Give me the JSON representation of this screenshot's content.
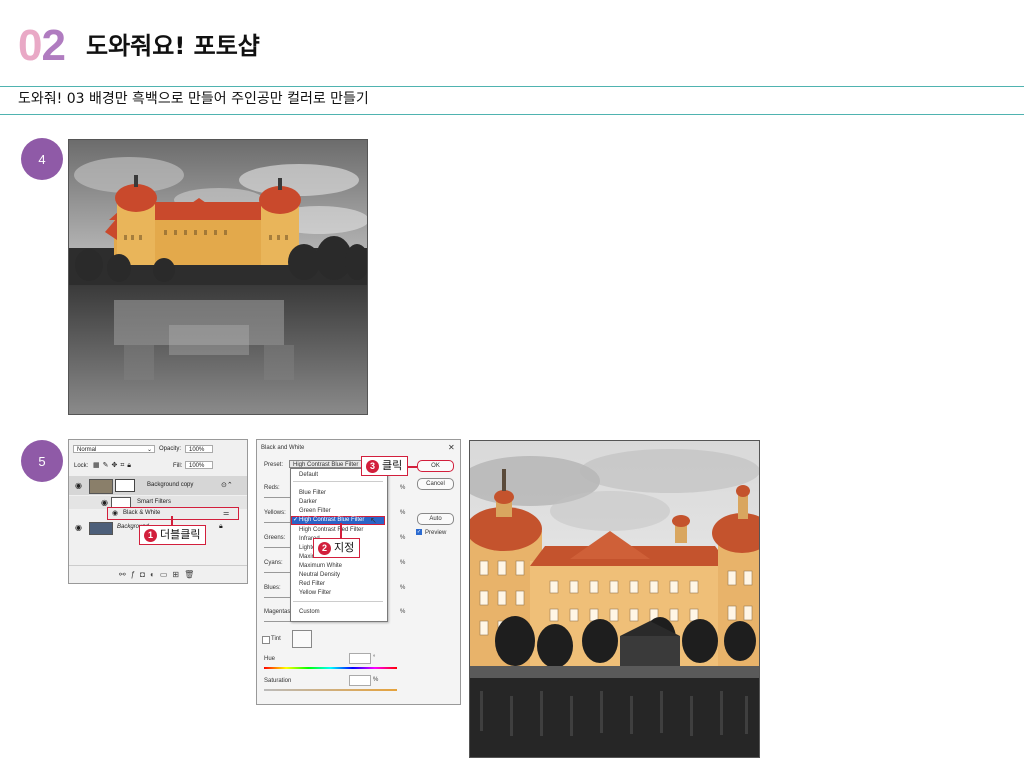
{
  "header": {
    "chapter_number": "02",
    "chapter_title": "도와줘요! 포토샵"
  },
  "subtitle": "도와줘! 03 배경만 흑백으로 만들어 주인공만 컬러로 만들기",
  "steps": {
    "step4": "4",
    "step5": "5"
  },
  "layers_panel": {
    "blend_mode": "Normal",
    "opacity_label": "Opacity:",
    "opacity_value": "100%",
    "lock_label": "Lock:",
    "fill_label": "Fill:",
    "fill_value": "100%",
    "layer_bg_copy": "Background copy",
    "smart_filters": "Smart Filters",
    "filter_bw": "Black & White",
    "layer_bg": "Background",
    "callout1_num": "1",
    "callout1_text": "더블클릭"
  },
  "bw_dialog": {
    "title": "Black and White",
    "preset_label": "Preset:",
    "preset_value": "High Contrast Blue Filter",
    "reds_label": "Reds:",
    "yellows_label": "Yellows:",
    "greens_label": "Greens:",
    "cyans_label": "Cyans:",
    "blues_label": "Blues:",
    "magentas_label": "Magentas:",
    "percent": "%",
    "ok": "OK",
    "cancel": "Cancel",
    "auto": "Auto",
    "preview": "Preview",
    "tint": "Tint",
    "hue": "Hue",
    "hue_unit": "°",
    "saturation": "Saturation",
    "sat_unit": "%",
    "dropdown_items": [
      "Default",
      "Blue Filter",
      "Darker",
      "Green Filter",
      "High Contrast Blue Filter",
      "High Contrast Red Filter",
      "Infrared",
      "Lighter",
      "Maximum Black",
      "Maximum White",
      "Neutral Density",
      "Red Filter",
      "Yellow Filter",
      "Custom"
    ],
    "callout2_num": "2",
    "callout2_text": "지정",
    "callout3_num": "3",
    "callout3_text": "클릭"
  }
}
